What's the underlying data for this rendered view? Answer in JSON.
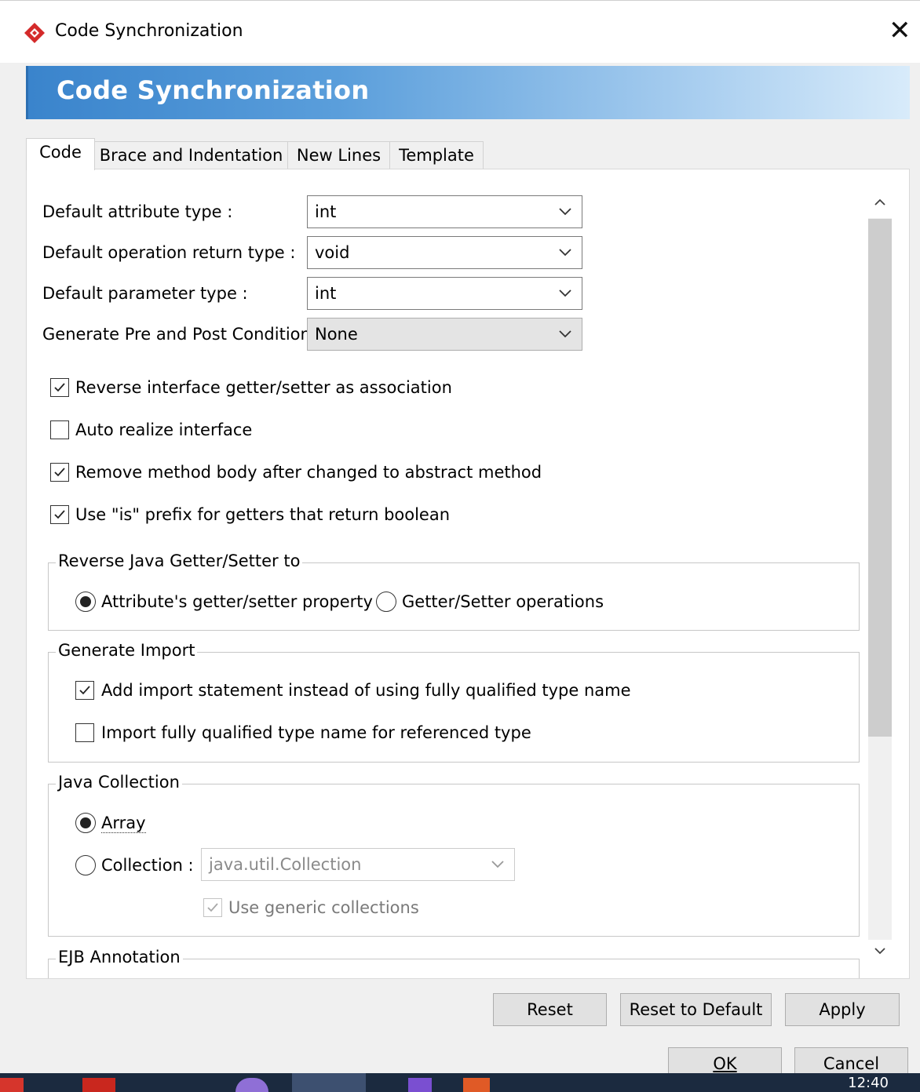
{
  "window": {
    "title": "Code Synchronization"
  },
  "banner": {
    "title": "Code Synchronization"
  },
  "tabs": [
    {
      "label": "Code",
      "active": true
    },
    {
      "label": "Brace and Indentation",
      "active": false
    },
    {
      "label": "New Lines",
      "active": false
    },
    {
      "label": "Template",
      "active": false
    }
  ],
  "fields": {
    "default_attribute_type": {
      "label": "Default attribute type :",
      "value": "int"
    },
    "default_operation_return_type": {
      "label": "Default operation return type :",
      "value": "void"
    },
    "default_parameter_type": {
      "label": "Default parameter type :",
      "value": "int"
    },
    "generate_pre_post_condition": {
      "label": "Generate Pre and Post Condition :",
      "value": "None"
    }
  },
  "checkboxes": {
    "reverse_interface": {
      "label": "Reverse interface getter/setter as association",
      "checked": true
    },
    "auto_realize": {
      "label": "Auto realize interface",
      "checked": false
    },
    "remove_method_body": {
      "label": "Remove method body after changed to abstract method",
      "checked": true
    },
    "use_is_prefix": {
      "label": "Use \"is\" prefix for getters that return boolean",
      "checked": true
    }
  },
  "reverse_java": {
    "title": "Reverse Java Getter/Setter to",
    "option_property": "Attribute's getter/setter property",
    "option_operations": "Getter/Setter operations",
    "selected": "property"
  },
  "generate_import": {
    "title": "Generate Import",
    "add_import": {
      "label": "Add import statement instead of using fully qualified type name",
      "checked": true
    },
    "import_fully_qualified": {
      "label": "Import fully qualified type name for referenced type",
      "checked": false
    }
  },
  "java_collection": {
    "title": "Java Collection",
    "array_label": "Array",
    "collection_label": "Collection :",
    "collection_value": "java.util.Collection",
    "use_generic_label": "Use generic collections",
    "use_generic_checked": true,
    "selected": "array"
  },
  "ejb": {
    "title": "EJB Annotation"
  },
  "buttons": {
    "reset": "Reset",
    "reset_default": "Reset to Default",
    "apply": "Apply",
    "ok": "OK",
    "cancel": "Cancel"
  },
  "taskbar": {
    "clock": "12:40"
  },
  "colors": {
    "banner_start": "#3a84cc",
    "banner_end": "#d8ebfa",
    "app_icon": "#d42a2a"
  }
}
